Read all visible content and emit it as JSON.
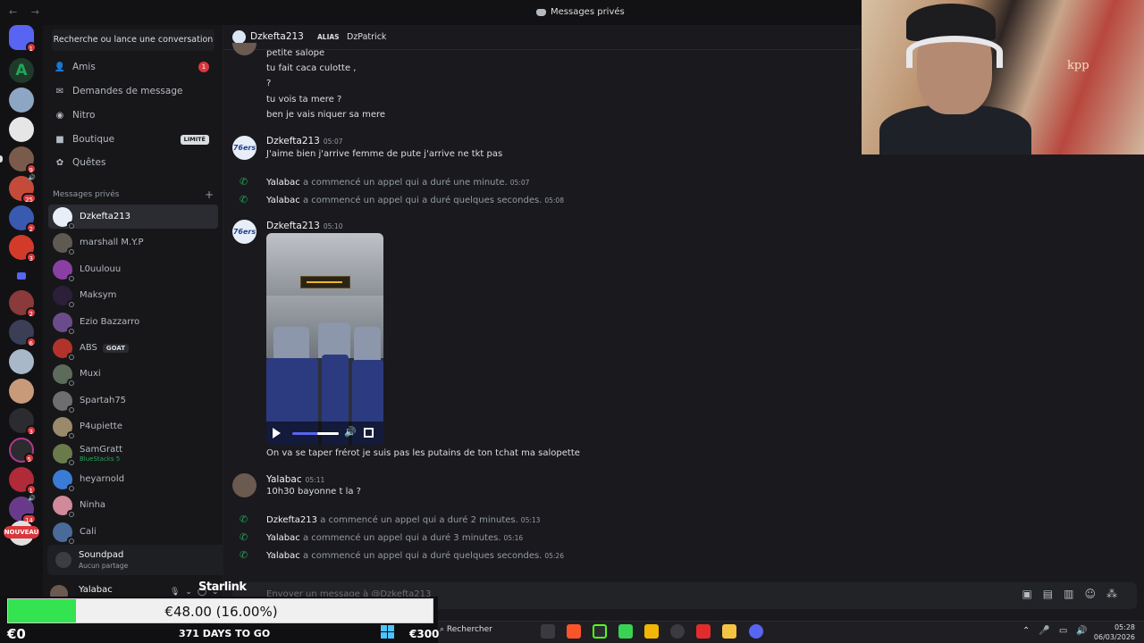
{
  "window": {
    "title": "Messages privés",
    "nav": "←  →"
  },
  "sidebar": {
    "search": "Recherche ou lance une conversation",
    "nav": [
      {
        "label": "Amis",
        "icon": "friends-icon",
        "badge": "1"
      },
      {
        "label": "Demandes de message",
        "icon": "mail-icon"
      },
      {
        "label": "Nitro",
        "icon": "nitro-icon"
      },
      {
        "label": "Boutique",
        "icon": "shop-icon",
        "tag": "LIMITÉ"
      },
      {
        "label": "Quêtes",
        "icon": "quests-icon"
      }
    ],
    "dm_header": "Messages privés",
    "dms": [
      {
        "name": "Dzkefta213",
        "color": "#e8eef8"
      },
      {
        "name": "marshall M.Y.P",
        "color": "#5e5a52"
      },
      {
        "name": "L0uulouu",
        "color": "#8a3fa3"
      },
      {
        "name": "Maksym",
        "color": "#2b1f3a"
      },
      {
        "name": "Ezio Bazzarro",
        "color": "#6b4c8a"
      },
      {
        "name": "ABS",
        "color": "#b2332c",
        "badge": "GOAT"
      },
      {
        "name": "Muxi",
        "color": "#5d6b5a"
      },
      {
        "name": "Spartah75",
        "color": "#6e6e6e"
      },
      {
        "name": "P4upiette",
        "color": "#9a8a6a"
      },
      {
        "name": "SamGratt",
        "color": "#6b7a4a",
        "activity": "BlueStacks 5"
      },
      {
        "name": "heyarnold",
        "color": "#3a7bd5"
      },
      {
        "name": "Ninha",
        "color": "#d08a9a"
      },
      {
        "name": "Cali",
        "color": "#4a6a9a"
      }
    ],
    "soundpad": {
      "title": "Soundpad",
      "subtitle": "Aucun partage"
    },
    "user": {
      "name": "Yalabac"
    }
  },
  "chat": {
    "header": {
      "name": "Dzkefta213",
      "alias_label": "ALIAS",
      "alias": "DzPatrick"
    },
    "top_lines": [
      "petite salope",
      "tu fait caca culotte ,",
      "?",
      "tu vois ta mere ?",
      "ben je vais niquer sa mere"
    ],
    "msg1": {
      "author": "Dzkefta213",
      "time": "05:07",
      "text": "J'aime bien j'arrive femme de pute j'arrive ne tkt pas"
    },
    "calls1": [
      {
        "who": "Yalabac",
        "text": "a commencé un appel qui a duré une minute.",
        "time": "05:07"
      },
      {
        "who": "Yalabac",
        "text": "a commencé un appel qui a duré quelques secondes.",
        "time": "05:08"
      }
    ],
    "msg2": {
      "author": "Dzkefta213",
      "time": "05:10",
      "text": "On va se taper frérot je suis pas les putains de ton tchat ma salopette"
    },
    "msg3": {
      "author": "Yalabac",
      "time": "05:11",
      "text": "10h30 bayonne t la ?"
    },
    "calls2": [
      {
        "who": "Dzkefta213",
        "text": "a commencé un appel qui a duré 2 minutes.",
        "time": "05:13"
      },
      {
        "who": "Yalabac",
        "text": "a commencé un appel qui a duré 3 minutes.",
        "time": "05:16"
      },
      {
        "who": "Yalabac",
        "text": "a commencé un appel qui a duré quelques secondes.",
        "time": "05:26"
      }
    ],
    "composer_placeholder": "Envoyer un message à @Dzkefta213"
  },
  "overlay": {
    "starlink": "Starlink",
    "goal_text": "€48.00 (16.00%)",
    "goal_progress": 0.16,
    "left_amount": "€0",
    "days": "371 DAYS TO GO",
    "right_amount": "€300"
  },
  "taskbar": {
    "search": "Rechercher",
    "time": "05:28",
    "date": "06/03/2026"
  },
  "webcam": {
    "shirt_text": "kpp"
  }
}
